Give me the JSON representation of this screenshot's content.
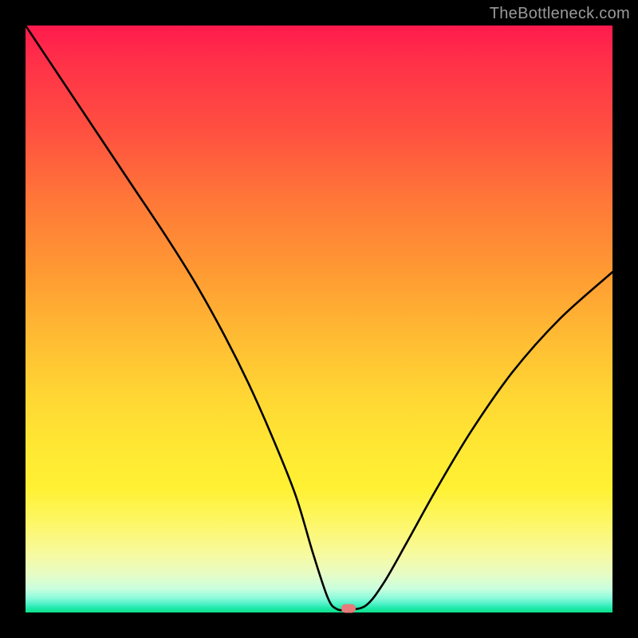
{
  "watermark": "TheBottleneck.com",
  "marker": {
    "x_pct": 55.0,
    "y_pct": 99.3
  },
  "chart_data": {
    "type": "line",
    "title": "",
    "xlabel": "",
    "ylabel": "",
    "xlim": [
      0,
      100
    ],
    "ylim": [
      0,
      100
    ],
    "grid": false,
    "legend": false,
    "annotations": [
      "TheBottleneck.com"
    ],
    "series": [
      {
        "name": "bottleneck-curve",
        "x": [
          0,
          6,
          12,
          18,
          24,
          29,
          34,
          38,
          42,
          46,
          49,
          51.5,
          53,
          55,
          58,
          61,
          65,
          70,
          76,
          83,
          91,
          100
        ],
        "y": [
          100,
          91,
          82,
          73,
          64,
          56,
          47,
          39,
          30,
          20,
          10,
          2.5,
          0.6,
          0.5,
          1.2,
          5,
          12,
          21,
          31,
          41,
          50,
          58
        ]
      }
    ],
    "background_gradient_stops": [
      {
        "pct": 0,
        "color": "#ff1a4d"
      },
      {
        "pct": 50,
        "color": "#ffc833"
      },
      {
        "pct": 85,
        "color": "#fdf76a"
      },
      {
        "pct": 100,
        "color": "#0de28a"
      }
    ],
    "marker_point": {
      "x": 55,
      "y": 0.5,
      "color": "#e77a7a"
    }
  }
}
